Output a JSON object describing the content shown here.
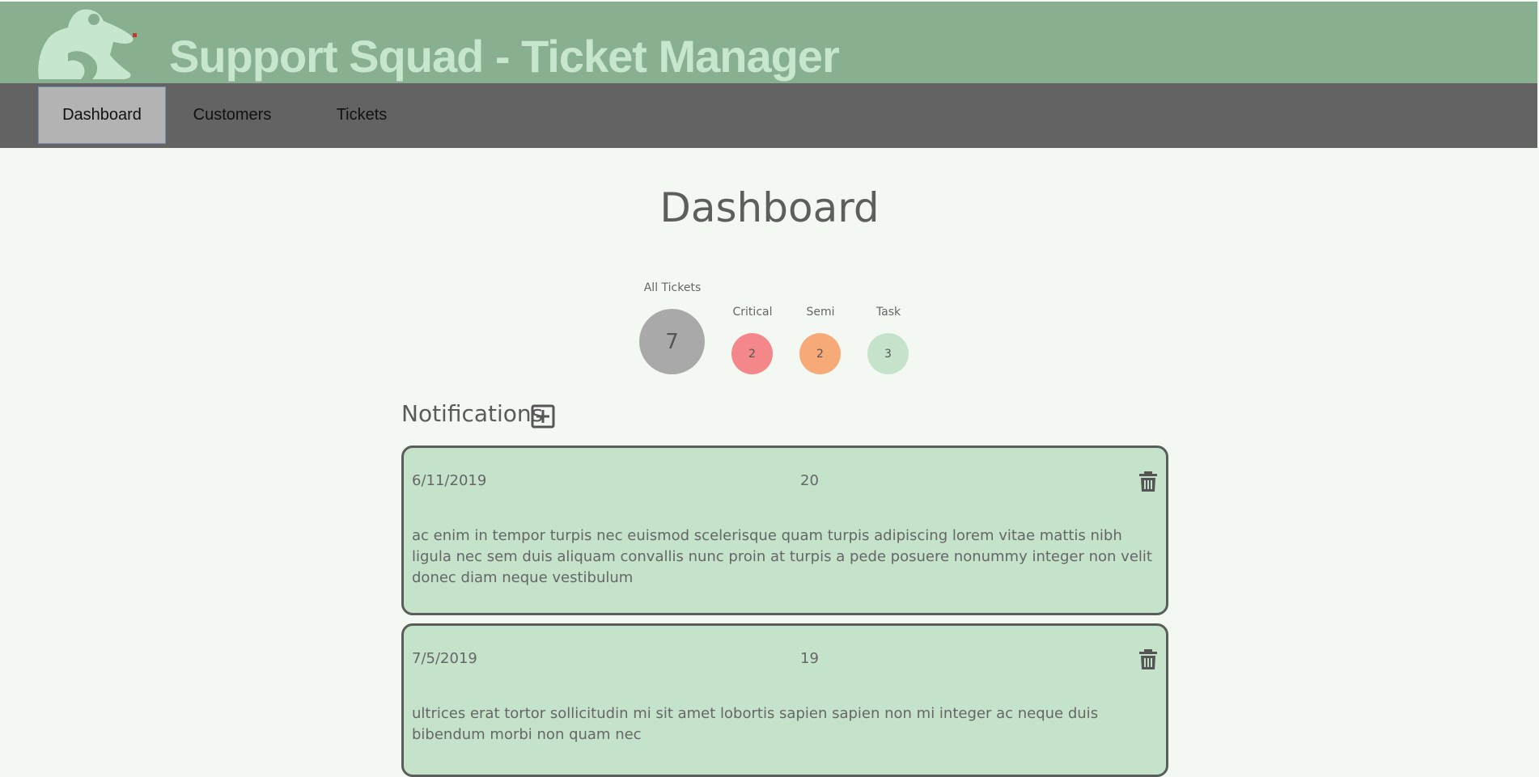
{
  "header": {
    "title": "Support Squad - Ticket Manager"
  },
  "nav": {
    "items": [
      {
        "label": "Dashboard",
        "active": true
      },
      {
        "label": "Customers",
        "active": false
      },
      {
        "label": "Tickets",
        "active": false
      }
    ]
  },
  "page": {
    "title": "Dashboard"
  },
  "stats": {
    "all": {
      "label": "All Tickets",
      "value": "7",
      "color": "#a9a9a9"
    },
    "critical": {
      "label": "Critical",
      "value": "2",
      "color": "#f4878a"
    },
    "semi": {
      "label": "Semi",
      "value": "2",
      "color": "#f6aa77"
    },
    "task": {
      "label": "Task",
      "value": "3",
      "color": "#c5e3cb"
    }
  },
  "notifications": {
    "heading": "Notifications",
    "add_icon": "plus-square-icon",
    "delete_icon": "trash-icon",
    "items": [
      {
        "date": "6/11/2019",
        "number": "20",
        "message": "ac enim in tempor turpis nec euismod scelerisque quam turpis adipiscing lorem vitae mattis nibh ligula nec sem duis aliquam convallis nunc proin at turpis a pede posuere nonummy integer non velit donec diam neque vestibulum"
      },
      {
        "date": "7/5/2019",
        "number": "19",
        "message": "ultrices erat tortor sollicitudin mi sit amet lobortis sapien sapien non mi integer ac neque duis bibendum morbi non quam nec"
      }
    ]
  },
  "colors": {
    "header_bg": "#89af91",
    "title_text": "#c7e6ce",
    "navbar_bg": "#636363",
    "nav_active_bg": "#b3b3b3",
    "page_bg": "#f4f8f2",
    "card_bg": "#c5e3cb"
  }
}
